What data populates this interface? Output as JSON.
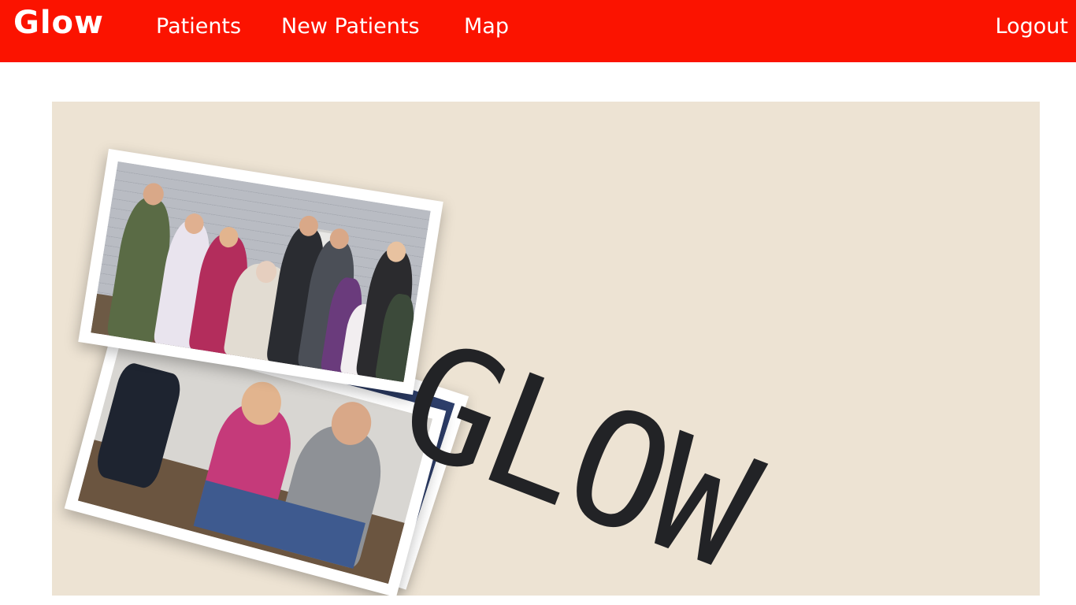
{
  "nav": {
    "brand": "Glow",
    "links": [
      "Patients",
      "New Patients",
      "Map"
    ],
    "logout": "Logout",
    "color": "#fb1300"
  },
  "hero": {
    "title": "GLOW",
    "background": "#ede3d3",
    "photos": [
      "family-group-photo",
      "couple-photo",
      "family-photo"
    ]
  }
}
